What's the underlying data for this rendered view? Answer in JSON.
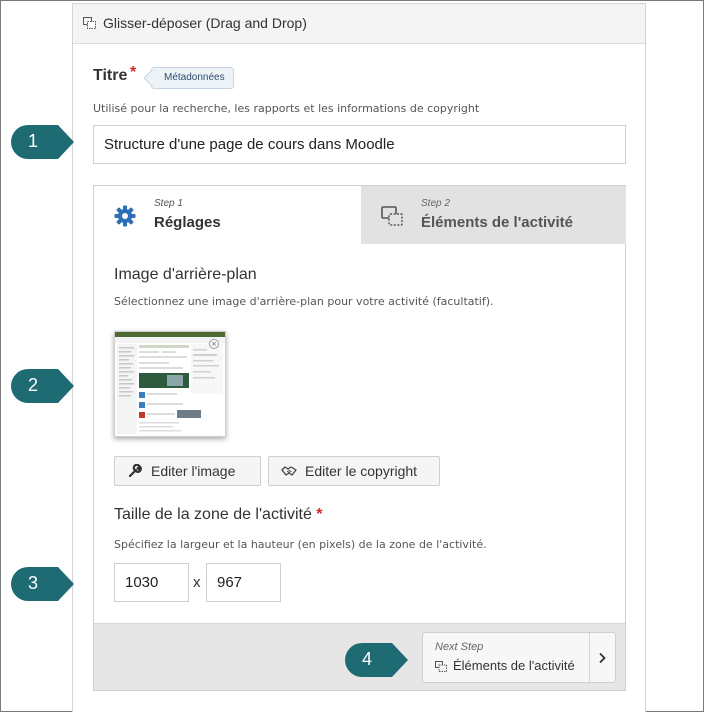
{
  "panel": {
    "header_title": "Glisser-déposer (Drag and Drop)"
  },
  "title_field": {
    "label": "Titre",
    "required_mark": "*",
    "metadata_tag": "Métadonnées",
    "help_text": "Utilisé pour la recherche, les rapports et les informations de copyright",
    "value": "Structure d'une page de cours dans Moodle"
  },
  "wizard": {
    "tabs": [
      {
        "step": "Step 1",
        "label": "Réglages",
        "icon": "gear-icon",
        "active": true
      },
      {
        "step": "Step 2",
        "label": "Éléments de l'activité",
        "icon": "drag-drop-icon",
        "active": false
      }
    ],
    "background": {
      "title": "Image d'arrière-plan",
      "help": "Sélectionnez une image d'arrière-plan pour votre activité (facultatif).",
      "thumbnail_close": "×",
      "edit_image_label": "Editer l'image",
      "edit_copyright_label": "Editer le copyright"
    },
    "size": {
      "title": "Taille de la zone de l'activité",
      "required_mark": "*",
      "help": "Spécifiez la largeur et la hauteur (en pixels) de la zone de l'activité.",
      "width": "1030",
      "separator": "x",
      "height": "967"
    },
    "next": {
      "label": "Next Step",
      "target": "Éléments de l'activité"
    }
  },
  "callouts": [
    "1",
    "2",
    "3",
    "4"
  ],
  "colors": {
    "callout": "#1f6b73",
    "gear": "#2c6fb5",
    "required": "#d9262a",
    "inactive_tab": "#e2e2e2",
    "footer_bar": "#e6e6e6"
  }
}
